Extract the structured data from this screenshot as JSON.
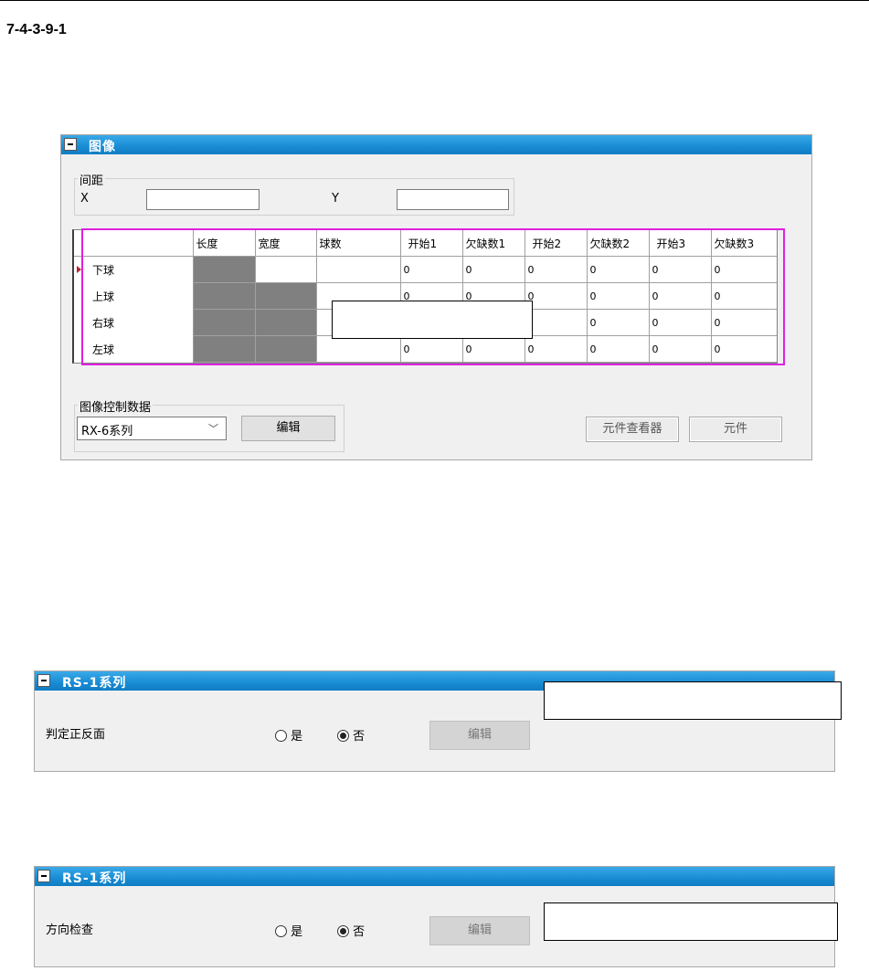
{
  "section_number": "7-4-3-9-1",
  "image_panel": {
    "title": "图像",
    "spacing_group": {
      "label": "间距",
      "x_label": "X",
      "x_value": "",
      "y_label": "Y",
      "y_value": ""
    },
    "grid": {
      "columns": [
        "",
        "长度",
        "宽度",
        "球数",
        "开始1",
        "欠缺数1",
        "开始2",
        "欠缺数2",
        "开始3",
        "欠缺数3"
      ],
      "rows": [
        {
          "name": "下球",
          "cells": [
            "",
            "",
            "",
            "0",
            "0",
            "0",
            "0",
            "0",
            "0"
          ]
        },
        {
          "name": "上球",
          "cells": [
            "",
            "",
            "",
            "0",
            "0",
            "0",
            "0",
            "0",
            "0"
          ]
        },
        {
          "name": "右球",
          "cells": [
            "",
            "",
            "",
            "",
            "",
            "",
            "0",
            "0",
            "0"
          ]
        },
        {
          "name": "左球",
          "cells": [
            "",
            "",
            "",
            "0",
            "0",
            "0",
            "0",
            "0",
            "0"
          ]
        }
      ]
    },
    "control_group": {
      "label": "图像控制数据",
      "selected": "RX-6系列",
      "edit_label": "编辑"
    },
    "viewer_button": "元件查看器",
    "part_button": "元件"
  },
  "rs_panel_1": {
    "title": "RS-1系列",
    "label": "判定正反面",
    "yes_label": "是",
    "no_label": "否",
    "selected": "no",
    "edit_label": "编辑"
  },
  "rs_panel_2": {
    "title": "RS-1系列",
    "label": "方向检查",
    "yes_label": "是",
    "no_label": "否",
    "selected": "no",
    "edit_label": "编辑"
  }
}
